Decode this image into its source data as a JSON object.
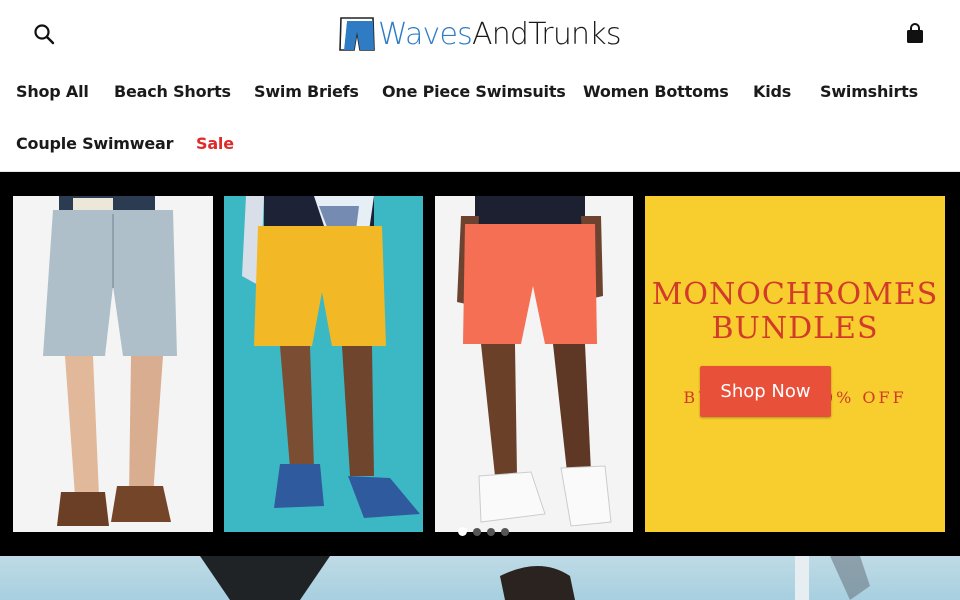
{
  "header": {
    "logo_text_waves": "Waves",
    "logo_text_rest": "AndTrunks",
    "search_icon": "search-icon",
    "cart_icon": "shopping-bag-icon"
  },
  "nav": {
    "items": [
      {
        "label": "Shop All"
      },
      {
        "label": "Beach Shorts"
      },
      {
        "label": "Swim Briefs"
      },
      {
        "label": "One Piece Swimsuits"
      },
      {
        "label": "Women Bottoms"
      },
      {
        "label": "Kids"
      },
      {
        "label": "Swimshirts"
      },
      {
        "label": "Couple Swimwear"
      },
      {
        "label": "Sale"
      }
    ]
  },
  "hero": {
    "promo_line1": "MONOCHROMES",
    "promo_line2": "BUNDLES",
    "promo_sub": "BUY 2 GET 20% OFF",
    "cta_label": "Shop Now",
    "slide_count": 4,
    "active_slide": 1
  },
  "colors": {
    "accent": "#e9503a",
    "sale": "#e02a2a",
    "promo_bg": "#f7ce2e",
    "logo_blue": "#2f7cc4"
  }
}
